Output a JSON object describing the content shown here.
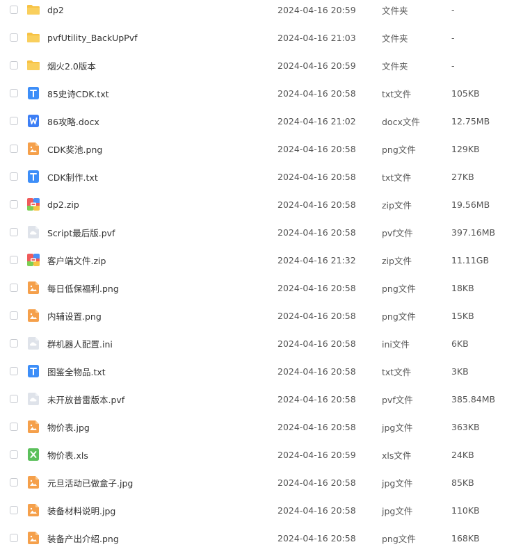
{
  "colors": {
    "folder": "#f7c244",
    "txt": "#3d8ef8",
    "docx": "#3d7ff5",
    "image": "#f5a04b",
    "zip_red": "#ef5b5b",
    "zip_blue": "#4b8ff7",
    "zip_green": "#7ccf55",
    "zip_yellow": "#f6c443",
    "generic": "#dfe3ea",
    "xls": "#5cc05c"
  },
  "files": [
    {
      "name": "dp2",
      "date": "2024-04-16 20:59",
      "type": "文件夹",
      "size": "-",
      "icon": "folder-icon"
    },
    {
      "name": "pvfUtility_BackUpPvf",
      "date": "2024-04-16 21:03",
      "type": "文件夹",
      "size": "-",
      "icon": "folder-icon"
    },
    {
      "name": "烟火2.0版本",
      "date": "2024-04-16 20:59",
      "type": "文件夹",
      "size": "-",
      "icon": "folder-icon"
    },
    {
      "name": "85史诗CDK.txt",
      "date": "2024-04-16 20:58",
      "type": "txt文件",
      "size": "105KB",
      "icon": "txt-file-icon"
    },
    {
      "name": "86攻略.docx",
      "date": "2024-04-16 21:02",
      "type": "docx文件",
      "size": "12.75MB",
      "icon": "word-file-icon"
    },
    {
      "name": "CDK奖池.png",
      "date": "2024-04-16 20:58",
      "type": "png文件",
      "size": "129KB",
      "icon": "image-file-icon"
    },
    {
      "name": "CDK制作.txt",
      "date": "2024-04-16 20:58",
      "type": "txt文件",
      "size": "27KB",
      "icon": "txt-file-icon"
    },
    {
      "name": "dp2.zip",
      "date": "2024-04-16 20:58",
      "type": "zip文件",
      "size": "19.56MB",
      "icon": "zip-file-icon"
    },
    {
      "name": "Script最后版.pvf",
      "date": "2024-04-16 20:58",
      "type": "pvf文件",
      "size": "397.16MB",
      "icon": "generic-file-icon"
    },
    {
      "name": "客户端文件.zip",
      "date": "2024-04-16 21:32",
      "type": "zip文件",
      "size": "11.11GB",
      "icon": "zip-file-icon"
    },
    {
      "name": "每日低保福利.png",
      "date": "2024-04-16 20:58",
      "type": "png文件",
      "size": "18KB",
      "icon": "image-file-icon"
    },
    {
      "name": "内辅设置.png",
      "date": "2024-04-16 20:58",
      "type": "png文件",
      "size": "15KB",
      "icon": "image-file-icon"
    },
    {
      "name": "群机器人配置.ini",
      "date": "2024-04-16 20:58",
      "type": "ini文件",
      "size": "6KB",
      "icon": "generic-file-icon"
    },
    {
      "name": "图鉴全物品.txt",
      "date": "2024-04-16 20:58",
      "type": "txt文件",
      "size": "3KB",
      "icon": "txt-file-icon"
    },
    {
      "name": "未开放普雷版本.pvf",
      "date": "2024-04-16 20:58",
      "type": "pvf文件",
      "size": "385.84MB",
      "icon": "generic-file-icon"
    },
    {
      "name": "物价表.jpg",
      "date": "2024-04-16 20:58",
      "type": "jpg文件",
      "size": "363KB",
      "icon": "image-file-icon"
    },
    {
      "name": "物价表.xls",
      "date": "2024-04-16 20:59",
      "type": "xls文件",
      "size": "24KB",
      "icon": "excel-file-icon"
    },
    {
      "name": "元旦活动已做盒子.jpg",
      "date": "2024-04-16 20:58",
      "type": "jpg文件",
      "size": "85KB",
      "icon": "image-file-icon"
    },
    {
      "name": "装备材料说明.jpg",
      "date": "2024-04-16 20:58",
      "type": "jpg文件",
      "size": "110KB",
      "icon": "image-file-icon"
    },
    {
      "name": "装备产出介绍.png",
      "date": "2024-04-16 20:58",
      "type": "png文件",
      "size": "168KB",
      "icon": "image-file-icon"
    }
  ]
}
